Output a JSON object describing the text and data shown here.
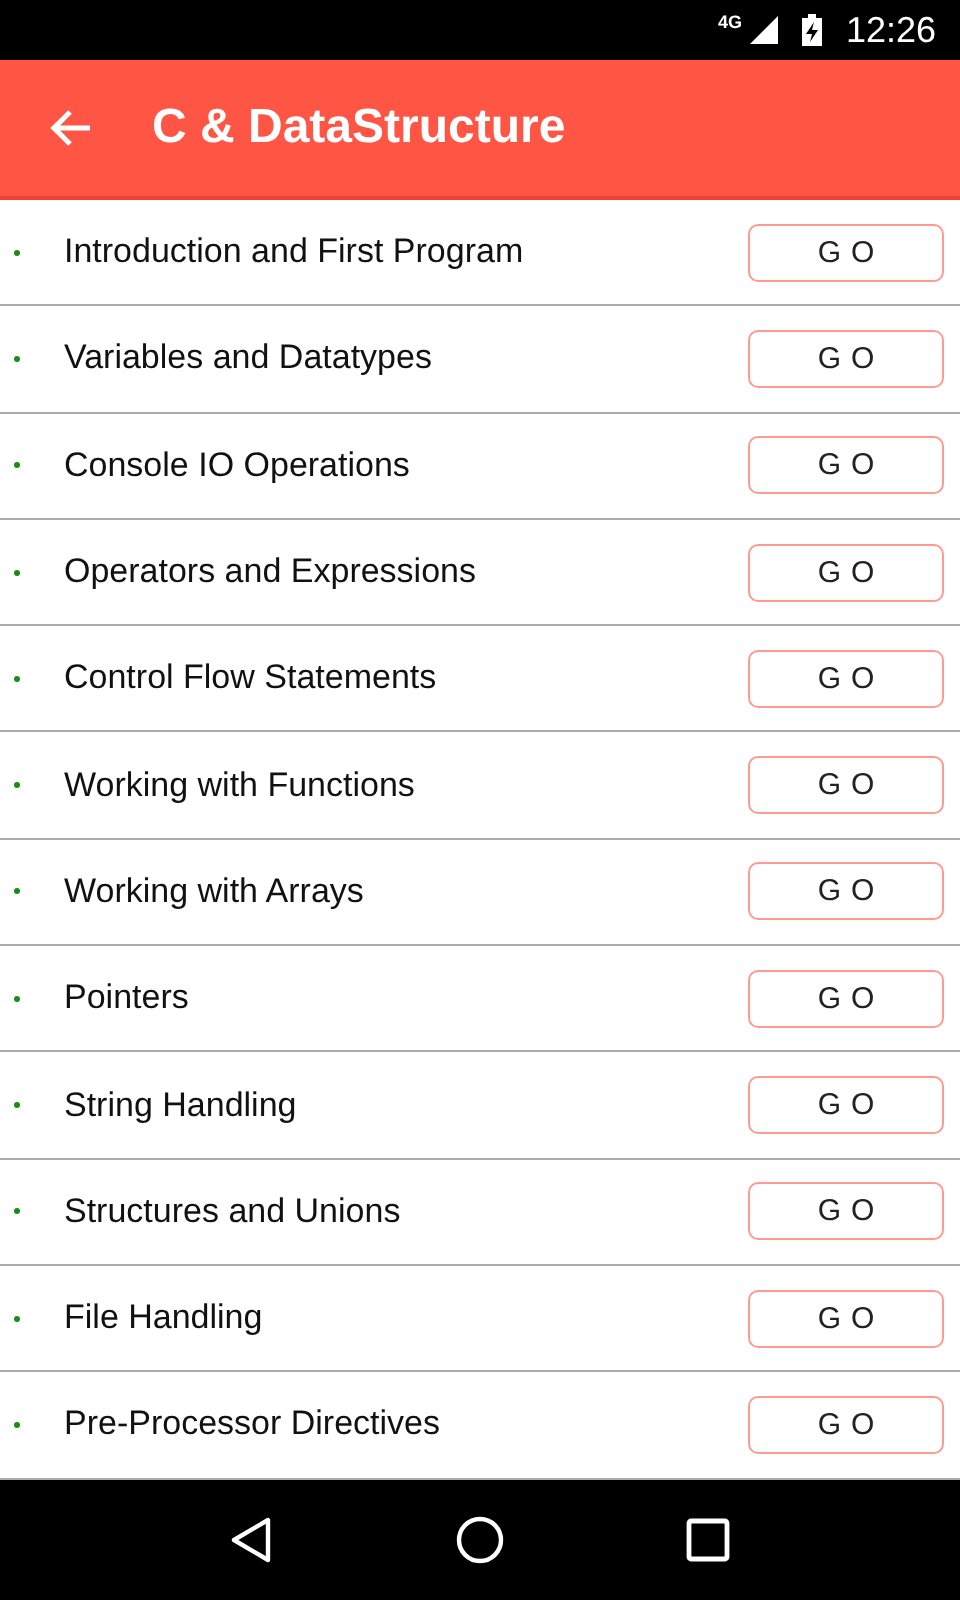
{
  "status_bar": {
    "network": "4G",
    "time": "12:26"
  },
  "app_bar": {
    "title": "C & DataStructure"
  },
  "topics": [
    {
      "title": "Introduction and First Program",
      "button": "GO"
    },
    {
      "title": "Variables and Datatypes",
      "button": "GO"
    },
    {
      "title": "Console IO Operations",
      "button": "GO"
    },
    {
      "title": "Operators and Expressions",
      "button": "GO"
    },
    {
      "title": "Control Flow Statements",
      "button": "GO"
    },
    {
      "title": "Working with Functions",
      "button": "GO"
    },
    {
      "title": "Working with Arrays",
      "button": "GO"
    },
    {
      "title": "Pointers",
      "button": "GO"
    },
    {
      "title": "String Handling",
      "button": "GO"
    },
    {
      "title": "Structures and Unions",
      "button": "GO"
    },
    {
      "title": "File Handling",
      "button": "GO"
    },
    {
      "title": "Pre-Processor Directives",
      "button": "GO"
    }
  ]
}
